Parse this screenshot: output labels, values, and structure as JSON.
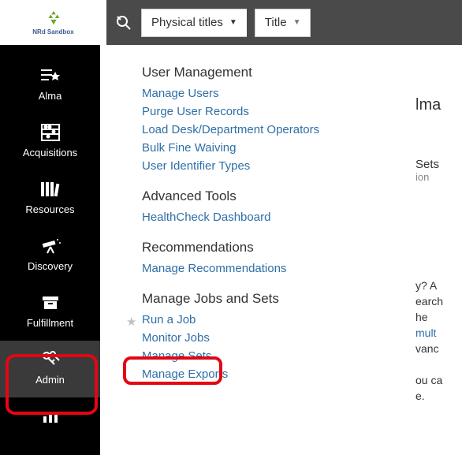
{
  "logo": {
    "text": "NRd Sandbox"
  },
  "topbar": {
    "select1": "Physical titles",
    "select2": "Title"
  },
  "sidebar": {
    "items": [
      {
        "label": "Alma"
      },
      {
        "label": "Acquisitions"
      },
      {
        "label": "Resources"
      },
      {
        "label": "Discovery"
      },
      {
        "label": "Fulfillment"
      },
      {
        "label": "Admin"
      },
      {
        "label": ""
      }
    ]
  },
  "menu": {
    "sections": [
      {
        "title": "User Management",
        "links": [
          "Manage Users",
          "Purge User Records",
          "Load Desk/Department Operators",
          "Bulk Fine Waiving",
          "User Identifier Types"
        ]
      },
      {
        "title": "Advanced Tools",
        "links": [
          "HealthCheck Dashboard"
        ]
      },
      {
        "title": "Recommendations",
        "links": [
          "Manage Recommendations"
        ]
      },
      {
        "title": "Manage Jobs and Sets",
        "links": [
          "Run a Job",
          "Monitor Jobs",
          "Manage Sets",
          "Manage Exports"
        ]
      }
    ]
  },
  "right": {
    "heading": "lma",
    "sub1": "Sets",
    "sub2": "ion",
    "frag1": "y? A",
    "frag2": "earch",
    "frag3": "he",
    "fraglink": "mult",
    "frag4": "vanc",
    "frag5": "ou ca",
    "frag6": "e."
  }
}
